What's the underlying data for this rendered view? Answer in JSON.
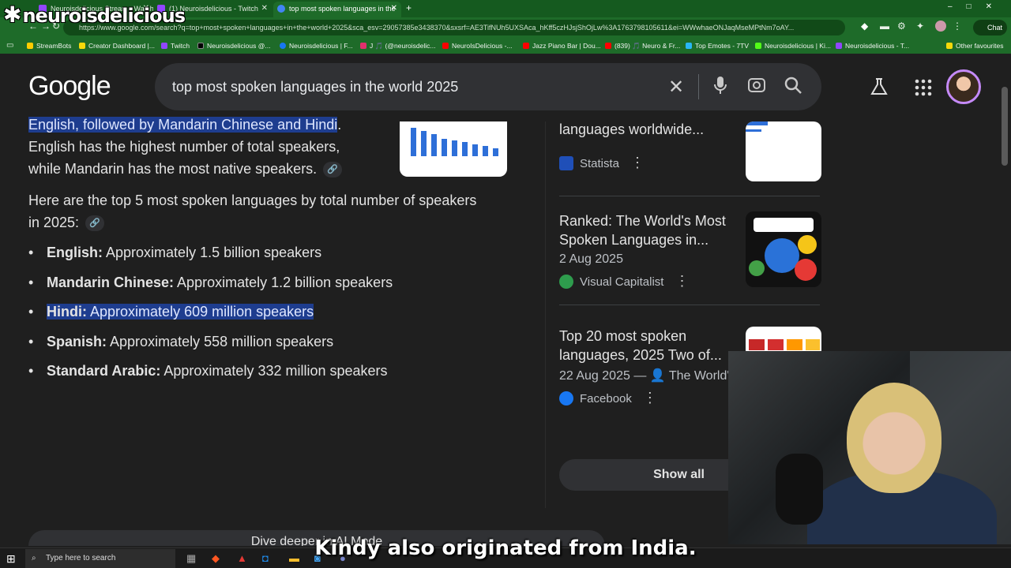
{
  "brand": {
    "text": "neuroisdelicious",
    "star": "✱"
  },
  "browser": {
    "tabs": [
      {
        "label": "Neuroisdelicious Stream - Watch",
        "color": "#9146ff"
      },
      {
        "label": "(1) Neuroisdelicious - Twitch",
        "color": "#9146ff"
      },
      {
        "label": "top most spoken languages in the",
        "color": "#4285f4"
      }
    ],
    "url": "https://www.google.com/search?q=top+most+spoken+languages+in+the+world+2025&sca_esv=29057385e3438370&sxsrf=AE3TifNUh5UXSAca_hKff5czHJsjShOjLw%3A1763798105611&ei=WWwhaeONJaqMseMPtNm7oAY...",
    "chat_label": "Chat",
    "bookmarks": [
      {
        "label": "StreamBots",
        "color": "#ffcc00"
      },
      {
        "label": "Creator Dashboard |...",
        "color": "#f5d90a"
      },
      {
        "label": "Twitch",
        "color": "#9146ff"
      },
      {
        "label": "Neuroisdelicious @...",
        "color": "#000000"
      },
      {
        "label": "Neuroisdelicious | F...",
        "color": "#1877f2"
      },
      {
        "label": "J 🎵 (@neuroisdelic...",
        "color": "#e1306c"
      },
      {
        "label": "NeuroIsDelicious -...",
        "color": "#ff0000"
      },
      {
        "label": "Jazz Piano Bar | Dou...",
        "color": "#ff0000"
      },
      {
        "label": "(839) 🎵 Neuro & Fr...",
        "color": "#ff0000"
      },
      {
        "label": "Top Emotes - 7TV",
        "color": "#29b6f6"
      },
      {
        "label": "Neuroisdelicious | Ki...",
        "color": "#53fc18"
      },
      {
        "label": "Neuroisdelicious - T...",
        "color": "#9146ff"
      },
      {
        "label": "Other favourites",
        "color": "#f5d90a"
      }
    ]
  },
  "google": {
    "logo": "Google",
    "query": "top most spoken languages in the world 2025",
    "icons": {
      "clear": "close-icon",
      "mic": "mic-icon",
      "lens": "lens-icon",
      "search": "search-icon",
      "labs": "flask-icon",
      "apps": "apps-icon"
    }
  },
  "overview": {
    "highlight_top": "English, followed by Mandarin Chinese and Hindi",
    "line2": "English has the highest number of total speakers,",
    "line3": "while Mandarin has the most native speakers.",
    "intro_line1": "Here are the top 5 most spoken languages by total number of speakers",
    "intro_line2": "in 2025:",
    "languages": [
      {
        "name": "English:",
        "desc": "Approximately 1.5 billion speakers",
        "selected": false
      },
      {
        "name": "Mandarin Chinese:",
        "desc": "Approximately 1.2 billion speakers",
        "selected": false
      },
      {
        "name": "Hindi:",
        "desc": "Approximately 609 million speakers",
        "selected": true
      },
      {
        "name": "Spanish:",
        "desc": "Approximately 558 million speakers",
        "selected": false
      },
      {
        "name": "Standard Arabic:",
        "desc": "Approximately 332 million speakers",
        "selected": false
      }
    ],
    "dive_deeper": "Dive deeper in AI Mode"
  },
  "sources": [
    {
      "title": "languages worldwide...",
      "date": "",
      "snippet": "",
      "site": "Statista",
      "site_color": "#1f4fb8"
    },
    {
      "title": "Ranked: The World's Most Spoken Languages in...",
      "date": "2 Aug 2025",
      "snippet": "",
      "site": "Visual Capitalist",
      "site_color": "#2e9c4d"
    },
    {
      "title": "Top 20 most spoken languages, 2025 Two of...",
      "date": "22 Aug 2025 —",
      "snippet": "The World's Most Spoken...",
      "site": "Facebook",
      "site_color": "#1877f2"
    }
  ],
  "show_all": "Show all",
  "subtitle": "Kindy also originated from India.",
  "taskbar": {
    "search_placeholder": "Type here to search"
  }
}
